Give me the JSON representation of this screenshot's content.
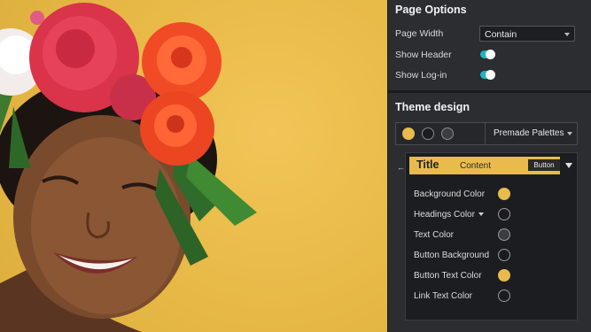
{
  "page_options": {
    "heading": "Page Options",
    "page_width_label": "Page Width",
    "page_width_value": "Contain",
    "show_header_label": "Show Header",
    "show_header_on": true,
    "show_login_label": "Show Log-in",
    "show_login_on": true
  },
  "theme_design": {
    "heading": "Theme design",
    "palette_dots": [
      "#e8bb4c",
      "#1c1c1e",
      "#3c3d41"
    ],
    "premade_label": "Premade Palettes",
    "preview": {
      "title": "Title",
      "content": "Content",
      "button": "Button"
    },
    "colors": [
      {
        "label": "Background Color",
        "color": "#e8bb4c"
      },
      {
        "label": "Headings Color",
        "color": "#1c1c1e",
        "has_dropdown": true
      },
      {
        "label": "Text Color",
        "color": "#3c3d41"
      },
      {
        "label": "Button Background",
        "color": "#1c1c1e"
      },
      {
        "label": "Button Text Color",
        "color": "#e8bb4c"
      },
      {
        "label": "Link Text Color",
        "color": "#1c1c1e"
      }
    ]
  },
  "colors": {
    "accent": "#e8bb4c",
    "panel_bg": "#2c2d31",
    "toggle_on": "#1fb3c4"
  }
}
